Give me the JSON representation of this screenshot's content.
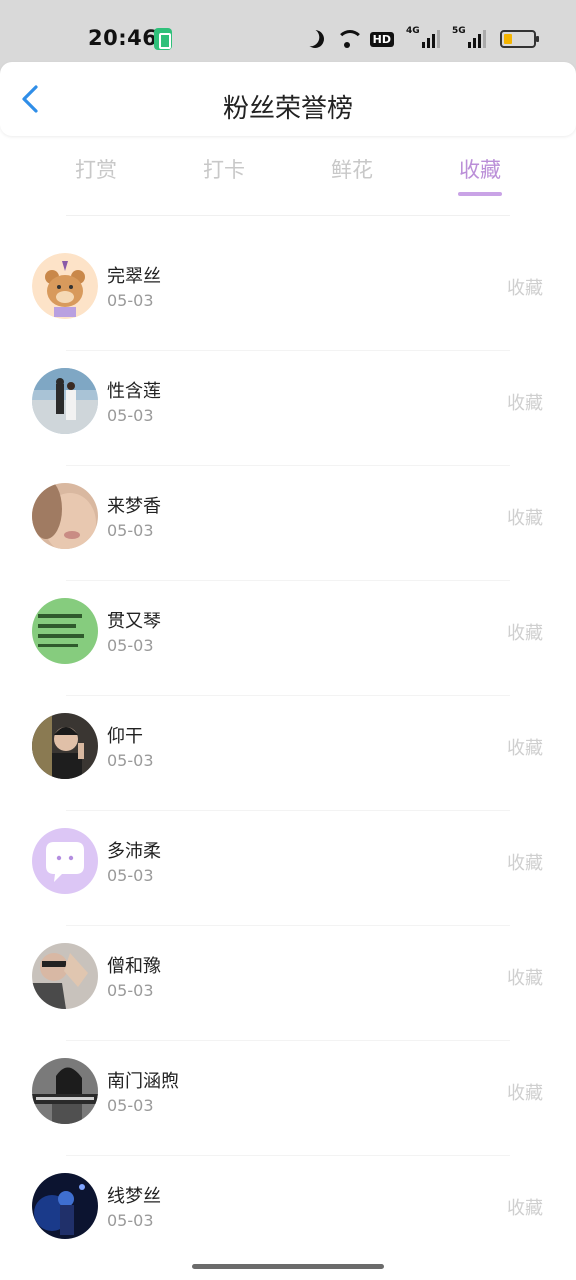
{
  "status_bar": {
    "time": "20:46",
    "hd_label": "HD",
    "signal_1": "4G",
    "signal_2": "5G"
  },
  "header": {
    "title": "粉丝荣誉榜"
  },
  "tabs": [
    {
      "label": "打赏",
      "active": false
    },
    {
      "label": "打卡",
      "active": false
    },
    {
      "label": "鲜花",
      "active": false
    },
    {
      "label": "收藏",
      "active": true
    }
  ],
  "accent_color": "#bb8fd8",
  "list": [
    {
      "name": "完翠丝",
      "date": "05-03",
      "action": "收藏",
      "avatar": "cartoon-bear"
    },
    {
      "name": "性含莲",
      "date": "05-03",
      "action": "收藏",
      "avatar": "photo-bridge"
    },
    {
      "name": "来梦香",
      "date": "05-03",
      "action": "收藏",
      "avatar": "photo-face"
    },
    {
      "name": "贯又琴",
      "date": "05-03",
      "action": "收藏",
      "avatar": "green-text"
    },
    {
      "name": "仰干",
      "date": "05-03",
      "action": "收藏",
      "avatar": "photo-person"
    },
    {
      "name": "多沛柔",
      "date": "05-03",
      "action": "收藏",
      "avatar": "default-chat"
    },
    {
      "name": "僧和豫",
      "date": "05-03",
      "action": "收藏",
      "avatar": "photo-hand"
    },
    {
      "name": "南门涵煦",
      "date": "05-03",
      "action": "收藏",
      "avatar": "photo-bw-woman"
    },
    {
      "name": "线梦丝",
      "date": "05-03",
      "action": "收藏",
      "avatar": "photo-night-blue"
    }
  ]
}
